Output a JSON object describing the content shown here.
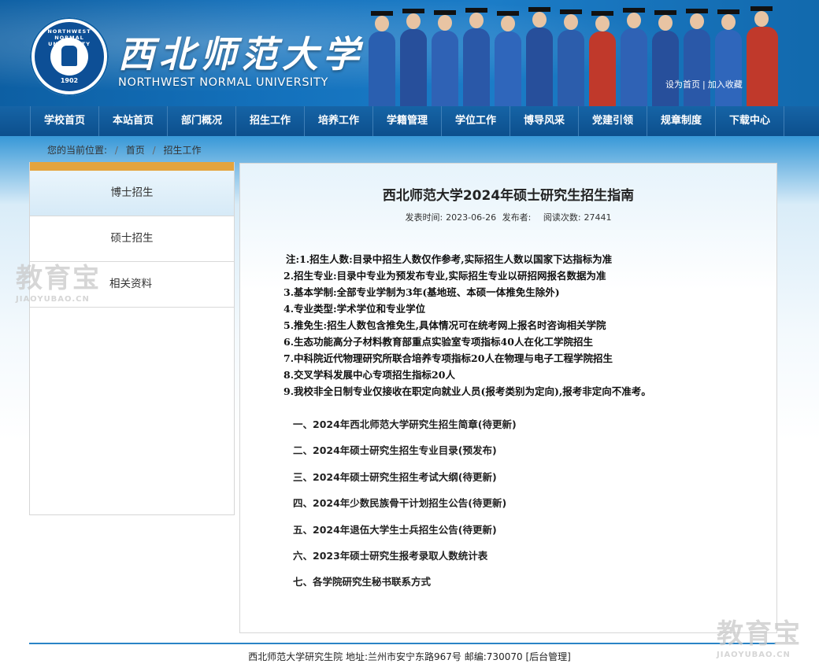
{
  "header": {
    "seal": {
      "arc_text": "NORTHWEST NORMAL UNIVERSITY",
      "year": "1902"
    },
    "title_cn": "西北师范大学",
    "title_en": "NORTHWEST NORMAL UNIVERSITY",
    "links": {
      "set_home": "设为首页",
      "separator": "|",
      "add_favorite": "加入收藏"
    }
  },
  "nav": {
    "items": [
      {
        "label": "学校首页"
      },
      {
        "label": "本站首页"
      },
      {
        "label": "部门概况"
      },
      {
        "label": "招生工作"
      },
      {
        "label": "培养工作"
      },
      {
        "label": "学籍管理"
      },
      {
        "label": "学位工作"
      },
      {
        "label": "博导风采"
      },
      {
        "label": "党建引领"
      },
      {
        "label": "规章制度"
      },
      {
        "label": "下载中心"
      }
    ]
  },
  "breadcrumb": {
    "prefix": "您的当前位置:",
    "sep": "/",
    "items": [
      "首页",
      "招生工作"
    ]
  },
  "sidebar": {
    "items": [
      {
        "label": "博士招生"
      },
      {
        "label": "硕士招生"
      },
      {
        "label": "相关资料"
      }
    ]
  },
  "article": {
    "title": "西北师范大学2024年硕士研究生招生指南",
    "meta": {
      "date_label": "发表时间:",
      "date": "2023-06-26",
      "author_label": "发布者:",
      "views_label": "阅读次数:",
      "views": "27441"
    },
    "notes": [
      "注:1.招生人数:目录中招生人数仅作参考,实际招生人数以国家下达指标为准",
      "2.招生专业:目录中专业为预发布专业,实际招生专业以研招网报名数据为准",
      "3.基本学制:全部专业学制为3年(基地班、本硕一体推免生除外)",
      "4.专业类型:学术学位和专业学位",
      "5.推免生:招生人数包含推免生,具体情况可在统考网上报名时咨询相关学院",
      "6.生态功能高分子材料教育部重点实验室专项指标40人在化工学院招生",
      "7.中科院近代物理研究所联合培养专项指标20人在物理与电子工程学院招生",
      "8.交叉学科发展中心专项招生指标20人",
      "9.我校非全日制专业仅接收在职定向就业人员(报考类别为定向),报考非定向不准考。"
    ],
    "links": [
      "一、2024年西北师范大学研究生招生简章(待更新)",
      "二、2024年硕士研究生招生专业目录(预发布)",
      "三、2024年硕士研究生招生考试大纲(待更新)",
      "四、2024年少数民族骨干计划招生公告(待更新)",
      "五、2024年退伍大学生士兵招生公告(待更新)",
      "六、2023年硕士研究生报考录取人数统计表",
      "七、各学院研究生秘书联系方式"
    ]
  },
  "footer": {
    "text": "西北师范大学研究生院 地址:兰州市安宁东路967号 邮编:730070",
    "admin": "[后台管理]"
  },
  "watermark": {
    "cn": "教育宝",
    "en": "JIAOYUBAO.CN"
  },
  "colors": {
    "nav_bg": "#0c4f8d",
    "sidebar_accent": "#e4a43d",
    "footer_line": "#2a84c6",
    "banner_blue": "#1472bd"
  }
}
